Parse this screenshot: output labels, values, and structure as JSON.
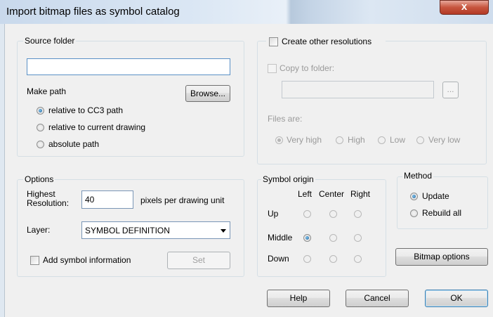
{
  "window": {
    "title": "Import bitmap files as symbol catalog",
    "close_glyph": "x"
  },
  "source_folder": {
    "label": "Source folder",
    "path_value": "",
    "make_path_label": "Make path",
    "browse_label": "Browse...",
    "options": [
      {
        "label": "relative to CC3 path",
        "selected": true
      },
      {
        "label": "relative to current drawing",
        "selected": false
      },
      {
        "label": "absolute path",
        "selected": false
      }
    ]
  },
  "resolutions": {
    "create_label": "Create other resolutions",
    "copy_label": "Copy to folder:",
    "folder_value": "",
    "ellipsis_label": "...",
    "files_are_label": "Files are:",
    "levels": [
      {
        "label": "Very high",
        "selected": true
      },
      {
        "label": "High",
        "selected": false
      },
      {
        "label": "Low",
        "selected": false
      },
      {
        "label": "Very low",
        "selected": false
      }
    ]
  },
  "options": {
    "label": "Options",
    "highest_res_label_1": "Highest",
    "highest_res_label_2": "Resolution:",
    "resolution_value": "40",
    "unit_label": "pixels per drawing unit",
    "layer_label": "Layer:",
    "layer_value": "SYMBOL DEFINITION",
    "add_info_label": "Add symbol information",
    "set_label": "Set"
  },
  "symbol_origin": {
    "label": "Symbol origin",
    "cols": [
      "Left",
      "Center",
      "Right"
    ],
    "rows": [
      "Up",
      "Middle",
      "Down"
    ],
    "selected": "Middle-Left"
  },
  "method": {
    "label": "Method",
    "options": [
      {
        "label": "Update",
        "selected": true
      },
      {
        "label": "Rebuild all",
        "selected": false
      }
    ]
  },
  "buttons": {
    "bitmap_options": "Bitmap options",
    "help": "Help",
    "cancel": "Cancel",
    "ok": "OK"
  }
}
